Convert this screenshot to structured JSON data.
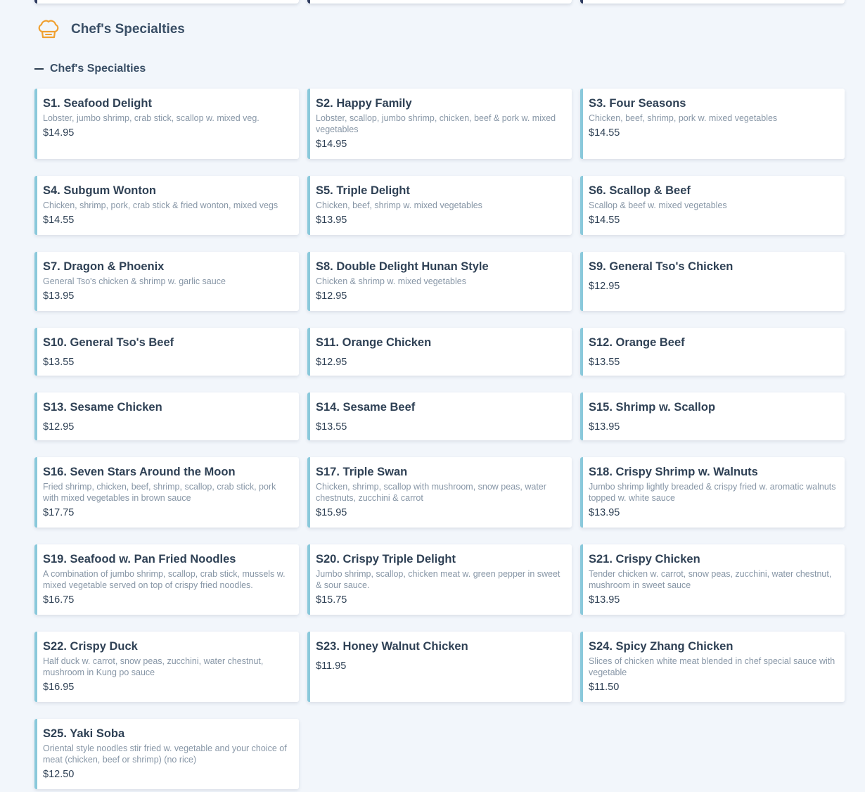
{
  "colors": {
    "background": "#f2f6fb",
    "card_accent": "#8ac9db",
    "icon_accent": "#f0a030",
    "text_primary": "#2f4155",
    "text_muted": "#8796a6"
  },
  "section": {
    "icon": "chef-hat-icon",
    "title": "Chef's Specialties"
  },
  "category": {
    "icon": "collapse-minus-icon",
    "title": "Chef's Specialties",
    "expanded": true
  },
  "items": [
    {
      "name": "S1. Seafood Delight",
      "desc": "Lobster, jumbo shrimp, crab stick, scallop w. mixed veg.",
      "price": "$14.95"
    },
    {
      "name": "S2. Happy Family",
      "desc": "Lobster, scallop, jumbo shrimp, chicken, beef & pork w. mixed vegetables",
      "price": "$14.95"
    },
    {
      "name": "S3. Four Seasons",
      "desc": "Chicken, beef, shrimp, pork w. mixed vegetables",
      "price": "$14.55"
    },
    {
      "name": "S4. Subgum Wonton",
      "desc": "Chicken, shrimp, pork, crab stick & fried wonton, mixed vegs",
      "price": "$14.55"
    },
    {
      "name": "S5. Triple Delight",
      "desc": "Chicken, beef, shrimp w. mixed vegetables",
      "price": "$13.95"
    },
    {
      "name": "S6. Scallop & Beef",
      "desc": "Scallop & beef w. mixed vegetables",
      "price": "$14.55"
    },
    {
      "name": "S7. Dragon & Phoenix",
      "desc": "General Tso's chicken & shrimp w. garlic sauce",
      "price": "$13.95"
    },
    {
      "name": "S8. Double Delight Hunan Style",
      "desc": "Chicken & shrimp w. mixed vegetables",
      "price": "$12.95"
    },
    {
      "name": "S9. General Tso's Chicken",
      "desc": "",
      "price": "$12.95"
    },
    {
      "name": "S10. General Tso's Beef",
      "desc": "",
      "price": "$13.55"
    },
    {
      "name": "S11. Orange Chicken",
      "desc": "",
      "price": "$12.95"
    },
    {
      "name": "S12. Orange Beef",
      "desc": "",
      "price": "$13.55"
    },
    {
      "name": "S13. Sesame Chicken",
      "desc": "",
      "price": "$12.95"
    },
    {
      "name": "S14. Sesame Beef",
      "desc": "",
      "price": "$13.55"
    },
    {
      "name": "S15. Shrimp w. Scallop",
      "desc": "",
      "price": "$13.95"
    },
    {
      "name": "S16. Seven Stars Around the Moon",
      "desc": "Fried shrimp, chicken, beef, shrimp, scallop, crab stick, pork with mixed vegetables in brown sauce",
      "price": "$17.75"
    },
    {
      "name": "S17. Triple Swan",
      "desc": "Chicken, shrimp, scallop with mushroom, snow peas, water chestnuts, zucchini & carrot",
      "price": "$15.95"
    },
    {
      "name": "S18. Crispy Shrimp w. Walnuts",
      "desc": "Jumbo shrimp lightly breaded & crispy fried w. aromatic walnuts topped w. white sauce",
      "price": "$13.95"
    },
    {
      "name": "S19. Seafood w. Pan Fried Noodles",
      "desc": "A combination of jumbo shrimp, scallop, crab stick, mussels w. mixed vegetable served on top of crispy fried noodles.",
      "price": "$16.75"
    },
    {
      "name": "S20. Crispy Triple Delight",
      "desc": "Jumbo shrimp, scallop, chicken meat w. green pepper in sweet & sour sauce.",
      "price": "$15.75"
    },
    {
      "name": "S21. Crispy Chicken",
      "desc": "Tender chicken w. carrot, snow peas, zucchini, water chestnut, mushroom in sweet sauce",
      "price": "$13.95"
    },
    {
      "name": "S22. Crispy Duck",
      "desc": "Half duck w. carrot, snow peas, zucchini, water chestnut, mushroom in Kung po sauce",
      "price": "$16.95"
    },
    {
      "name": "S23. Honey Walnut Chicken",
      "desc": "",
      "price": "$11.95"
    },
    {
      "name": "S24. Spicy Zhang Chicken",
      "desc": "Slices of chicken white meat blended in chef special sauce with vegetable",
      "price": "$11.50"
    },
    {
      "name": "S25. Yaki Soba",
      "desc": "Oriental style noodles stir fried w. vegetable and your choice of meat (chicken, beef or shrimp) (no rice)",
      "price": "$12.50"
    }
  ]
}
